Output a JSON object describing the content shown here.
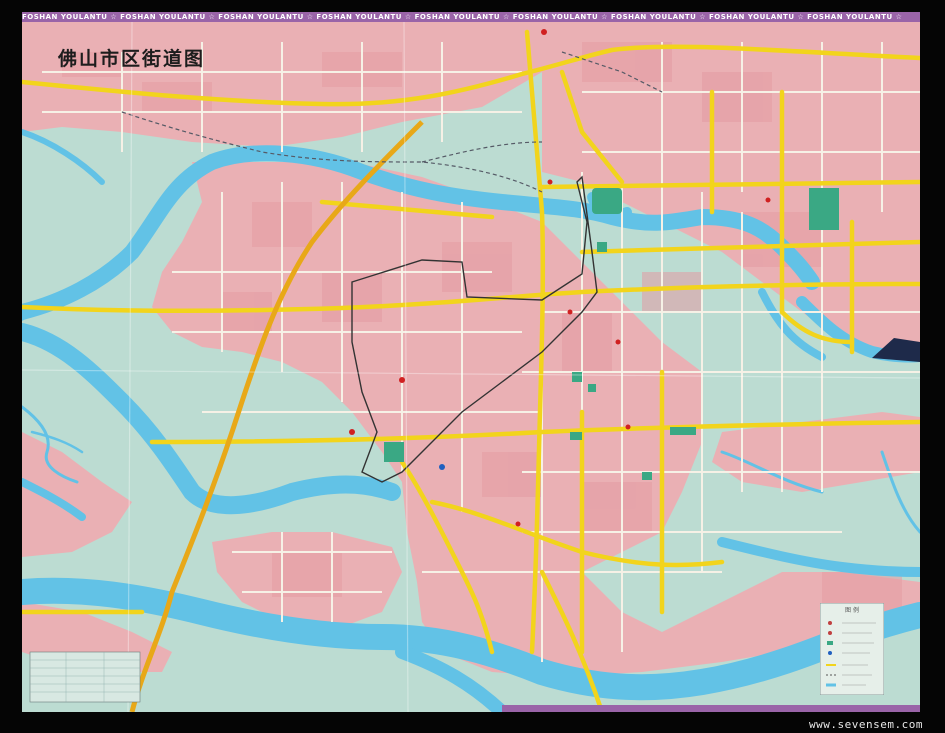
{
  "map": {
    "title": "佛山市区街道图",
    "banner": "FOSHAN YOULANTU ☆ FOSHAN YOULANTU ☆ FOSHAN YOULANTU ☆ FOSHAN YOULANTU ☆ FOSHAN YOULANTU ☆ FOSHAN YOULANTU ☆ FOSHAN YOULANTU ☆ FOSHAN YOULANTU ☆ FOSHAN YOULANTU ☆",
    "legend_title": "图 例",
    "watermark": "www.sevensem.com",
    "colors": {
      "land": "#bcdcd2",
      "urban": "#eab0b4",
      "water": "#62c2e6",
      "major_road": "#f2d41c",
      "street": "#f6f1e6",
      "park": "#3aa884",
      "railway": "#555a66",
      "frame": "#050505",
      "banner": "#9a64a8"
    }
  }
}
